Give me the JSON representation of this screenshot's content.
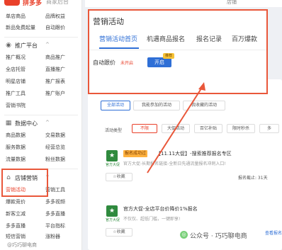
{
  "app": {
    "logo_text": "拼多多",
    "logo_sub": "商家后台"
  },
  "sidebar": {
    "top_rows": [
      {
        "c1": "单店商品",
        "c2": "品牌权益"
      },
      {
        "c1": "新品免费起量",
        "c2": "自动跟价"
      }
    ],
    "sections": [
      {
        "label": "推广平台",
        "arrow": "^",
        "icon": "megaphone-icon",
        "rows": [
          {
            "c1": "推广概况",
            "c2": "商品推广"
          },
          {
            "c1": "全店托管",
            "c2": "直播推广"
          },
          {
            "c1": "明星店铺",
            "c2": "推广报表"
          },
          {
            "c1": "推广工具",
            "c2": "推广账户"
          },
          {
            "c1": "营销书院",
            "c2": ""
          }
        ]
      },
      {
        "label": "数据中心",
        "arrow": "^",
        "icon": "chart-icon",
        "rows": [
          {
            "c1": "商品数据",
            "c2": "交易数据"
          },
          {
            "c1": "服务数据",
            "c2": "经营总览"
          },
          {
            "c1": "流量数据",
            "c2": "粉丝数据"
          }
        ]
      },
      {
        "label": "店铺营销",
        "arrow": "^",
        "icon": "store-icon",
        "rows": [
          {
            "c1": "营销活动",
            "c2": "营销工具",
            "active": true
          },
          {
            "c1": "爆款竞价",
            "c2": "多多视频"
          },
          {
            "c1": "新客立减",
            "c2": "多多直播"
          },
          {
            "c1": "多多直播",
            "c2": "平台指标"
          },
          {
            "c1": "短信营销",
            "c2": "涨粉器"
          }
        ]
      }
    ]
  },
  "header": {
    "top_text": "店铺"
  },
  "campaign": {
    "title": "营销活动",
    "tabs": [
      "营销活动首页",
      "机遇商品报名",
      "报名记录",
      "百万爆款"
    ],
    "auto_follow_label": "自动跟价",
    "auto_follow_state": "未开启",
    "open_button": "开启",
    "open_badge": "推荐"
  },
  "signup": {
    "title": "营销活动报名",
    "subtabs": [
      "全部活动",
      "我能参加的活动",
      "我收藏的活动"
    ],
    "type_label": "活动类型",
    "chips": [
      "不限",
      "大促活动",
      "百亿补贴",
      "限时秒杀",
      "多"
    ],
    "items": [
      {
        "icon_label": "官方大促",
        "badge": "报名成功过",
        "name": "【11.11大促】-搜索推荐报名专区",
        "desc": "官方大促-长期报名链接-全新日先通流量报名冲刺入口!",
        "fav": "☆收藏",
        "deadline": "报名截止: 31天",
        "link": ""
      },
      {
        "icon_label": "官方大促",
        "badge": "",
        "name": "官方大促-全店平台价降价1%报名",
        "desc": "不仅仅、超低门槛，一键即享!",
        "fav": "☆收藏",
        "deadline": "",
        "link": "查看报名"
      }
    ]
  },
  "watermark": {
    "text": "公众号 · 巧巧聊电商",
    "icon": "wechat-icon"
  },
  "bottom_note": "@巧巧聊电商"
}
